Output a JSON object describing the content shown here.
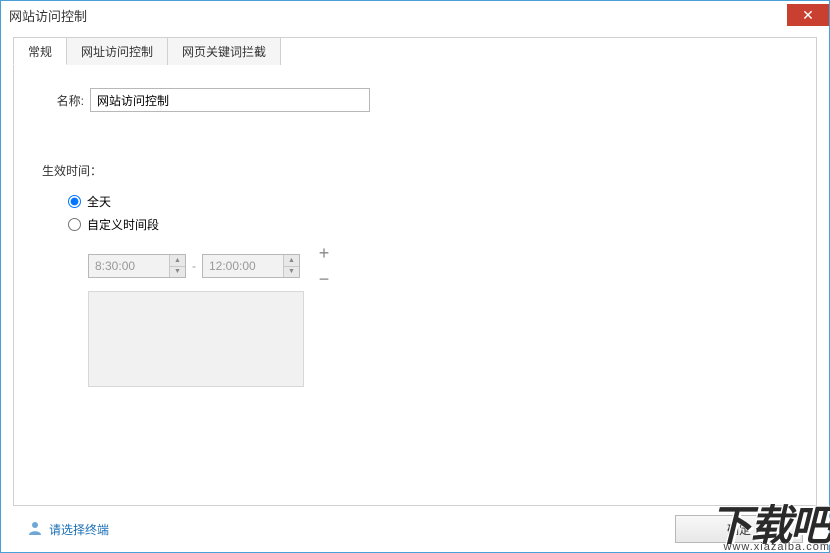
{
  "window": {
    "title": "网站访问控制"
  },
  "tabs": [
    {
      "label": "常规",
      "active": true
    },
    {
      "label": "网址访问控制",
      "active": false
    },
    {
      "label": "网页关键词拦截",
      "active": false
    }
  ],
  "form": {
    "name_label": "名称:",
    "name_value": "网站访问控制",
    "effective_time_label": "生效时间：",
    "radio_all_day": "全天",
    "radio_custom": "自定义时间段",
    "radio_selected": "all_day",
    "time_start": "8:30:00",
    "time_end": "12:00:00"
  },
  "footer": {
    "terminal_link": "请选择终端",
    "ok_button": "确定"
  },
  "watermark": {
    "brand": "下载吧",
    "url": "www.xiazaiba.com"
  }
}
